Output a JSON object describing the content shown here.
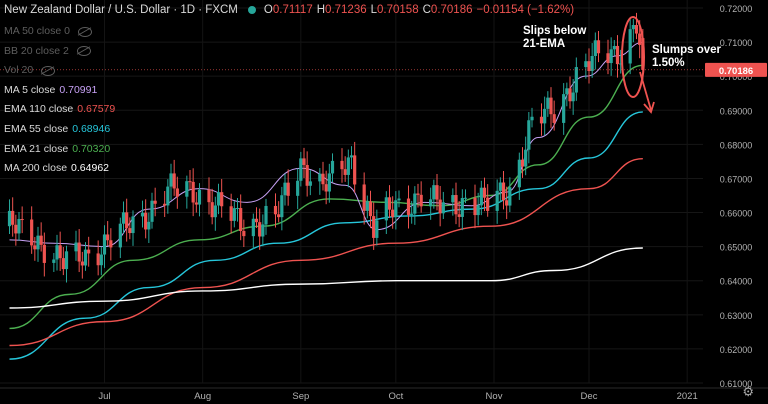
{
  "header": {
    "symbol_title": "New Zealand Dollar / U.S. Dollar · 1D · FXCM",
    "ohlc": [
      {
        "key": "O",
        "value": "0.71117"
      },
      {
        "key": "H",
        "value": "0.71236"
      },
      {
        "key": "L",
        "value": "0.70158"
      },
      {
        "key": "C",
        "value": "0.70186"
      },
      {
        "key": "",
        "value": "−0.01154 (−1.62%)"
      }
    ]
  },
  "legend": {
    "hidden": [
      {
        "label": "MA 50 close 0"
      },
      {
        "label": "BB 20 close 2"
      },
      {
        "label": "Vol 20"
      }
    ],
    "indicators": [
      {
        "label": "MA 5 close",
        "value": "0.70991",
        "color": "#c7a1f5"
      },
      {
        "label": "EMA 110 close",
        "value": "0.67579",
        "color": "#ef5350"
      },
      {
        "label": "EMA 55 close",
        "value": "0.68946",
        "color": "#26c6da"
      },
      {
        "label": "EMA 21 close",
        "value": "0.70320",
        "color": "#4caf50"
      },
      {
        "label": "MA 200 close",
        "value": "0.64962",
        "color": "#ffffff"
      }
    ]
  },
  "annotations": {
    "note1": [
      "Slips below",
      "21-EMA"
    ],
    "note2": [
      "Slumps over",
      "1.50%"
    ]
  },
  "current_price": "0.70186",
  "colors": {
    "up": "#26a69a",
    "down": "#ef5350",
    "ema21": "#4caf50",
    "ema55": "#26c6da",
    "ema110": "#ef5350",
    "ma200": "#ffffff",
    "ma5": "#c7a1f5",
    "price_tag": "#ef5350"
  },
  "chart_data": {
    "type": "candlestick",
    "title": "New Zealand Dollar / U.S. Dollar · 1D · FXCM",
    "y_ticks": [
      "0.72000",
      "0.71000",
      "0.70000",
      "0.69000",
      "0.68000",
      "0.67000",
      "0.66000",
      "0.65000",
      "0.64000",
      "0.63000",
      "0.62000",
      "0.61000"
    ],
    "ylim": [
      0.61,
      0.72
    ],
    "x_ticks": [
      "Jul",
      "Aug",
      "Sep",
      "Oct",
      "Nov",
      "Dec",
      "2021"
    ],
    "x_tick_dates": [
      "2020-07-01",
      "2020-08-01",
      "2020-09-01",
      "2020-10-01",
      "2020-11-01",
      "2020-12-01",
      "2021-01-01"
    ],
    "x_range": [
      "2020-05-29",
      "2021-01-06"
    ],
    "series": [
      {
        "name": "EMA 21",
        "points": [
          [
            "2020-06-01",
            0.626
          ],
          [
            "2020-06-20",
            0.636
          ],
          [
            "2020-07-10",
            0.646
          ],
          [
            "2020-07-31",
            0.652
          ],
          [
            "2020-08-20",
            0.656
          ],
          [
            "2020-09-10",
            0.664
          ],
          [
            "2020-09-28",
            0.663
          ],
          [
            "2020-10-15",
            0.662
          ],
          [
            "2020-10-31",
            0.665
          ],
          [
            "2020-11-15",
            0.674
          ],
          [
            "2020-12-01",
            0.688
          ],
          [
            "2020-12-18",
            0.7032
          ]
        ]
      },
      {
        "name": "EMA 55",
        "points": [
          [
            "2020-06-01",
            0.617
          ],
          [
            "2020-06-25",
            0.629
          ],
          [
            "2020-07-15",
            0.638
          ],
          [
            "2020-08-05",
            0.646
          ],
          [
            "2020-08-25",
            0.651
          ],
          [
            "2020-09-15",
            0.657
          ],
          [
            "2020-10-05",
            0.659
          ],
          [
            "2020-10-25",
            0.661
          ],
          [
            "2020-11-15",
            0.667
          ],
          [
            "2020-12-01",
            0.676
          ],
          [
            "2020-12-18",
            0.6895
          ]
        ]
      },
      {
        "name": "EMA 110",
        "points": [
          [
            "2020-06-01",
            0.621
          ],
          [
            "2020-07-01",
            0.628
          ],
          [
            "2020-08-01",
            0.638
          ],
          [
            "2020-09-01",
            0.646
          ],
          [
            "2020-10-01",
            0.651
          ],
          [
            "2020-10-31",
            0.656
          ],
          [
            "2020-12-01",
            0.667
          ],
          [
            "2020-12-18",
            0.6758
          ]
        ]
      },
      {
        "name": "MA 200",
        "points": [
          [
            "2020-06-01",
            0.632
          ],
          [
            "2020-07-01",
            0.634
          ],
          [
            "2020-08-01",
            0.637
          ],
          [
            "2020-09-01",
            0.639
          ],
          [
            "2020-10-01",
            0.64
          ],
          [
            "2020-10-31",
            0.64
          ],
          [
            "2020-11-20",
            0.643
          ],
          [
            "2020-12-18",
            0.6496
          ]
        ]
      },
      {
        "name": "MA 5",
        "points": [
          [
            "2020-06-01",
            0.652
          ],
          [
            "2020-06-15",
            0.651
          ],
          [
            "2020-07-01",
            0.65
          ],
          [
            "2020-07-15",
            0.661
          ],
          [
            "2020-07-31",
            0.667
          ],
          [
            "2020-08-15",
            0.663
          ],
          [
            "2020-09-01",
            0.673
          ],
          [
            "2020-09-15",
            0.668
          ],
          [
            "2020-09-25",
            0.655
          ],
          [
            "2020-10-10",
            0.663
          ],
          [
            "2020-10-25",
            0.662
          ],
          [
            "2020-11-05",
            0.666
          ],
          [
            "2020-11-15",
            0.682
          ],
          [
            "2020-11-30",
            0.7
          ],
          [
            "2020-12-10",
            0.706
          ],
          [
            "2020-12-18",
            0.7099
          ]
        ]
      }
    ],
    "close_path": [
      [
        "2020-06-01",
        0.656
      ],
      [
        "2020-06-10",
        0.652
      ],
      [
        "2020-06-18",
        0.645
      ],
      [
        "2020-06-26",
        0.648
      ],
      [
        "2020-07-03",
        0.652
      ],
      [
        "2020-07-13",
        0.659
      ],
      [
        "2020-07-21",
        0.666
      ],
      [
        "2020-07-29",
        0.667
      ],
      [
        "2020-08-06",
        0.661
      ],
      [
        "2020-08-14",
        0.657
      ],
      [
        "2020-08-24",
        0.658
      ],
      [
        "2020-09-01",
        0.675
      ],
      [
        "2020-09-08",
        0.667
      ],
      [
        "2020-09-17",
        0.676
      ],
      [
        "2020-09-24",
        0.655
      ],
      [
        "2020-10-01",
        0.662
      ],
      [
        "2020-10-09",
        0.665
      ],
      [
        "2020-10-16",
        0.661
      ],
      [
        "2020-10-23",
        0.664
      ],
      [
        "2020-10-30",
        0.662
      ],
      [
        "2020-11-06",
        0.667
      ],
      [
        "2020-11-13",
        0.686
      ],
      [
        "2020-11-20",
        0.69
      ],
      [
        "2020-11-27",
        0.7
      ],
      [
        "2020-12-04",
        0.706
      ],
      [
        "2020-12-11",
        0.708
      ],
      [
        "2020-12-16",
        0.715
      ],
      [
        "2020-12-18",
        0.70186
      ]
    ]
  }
}
